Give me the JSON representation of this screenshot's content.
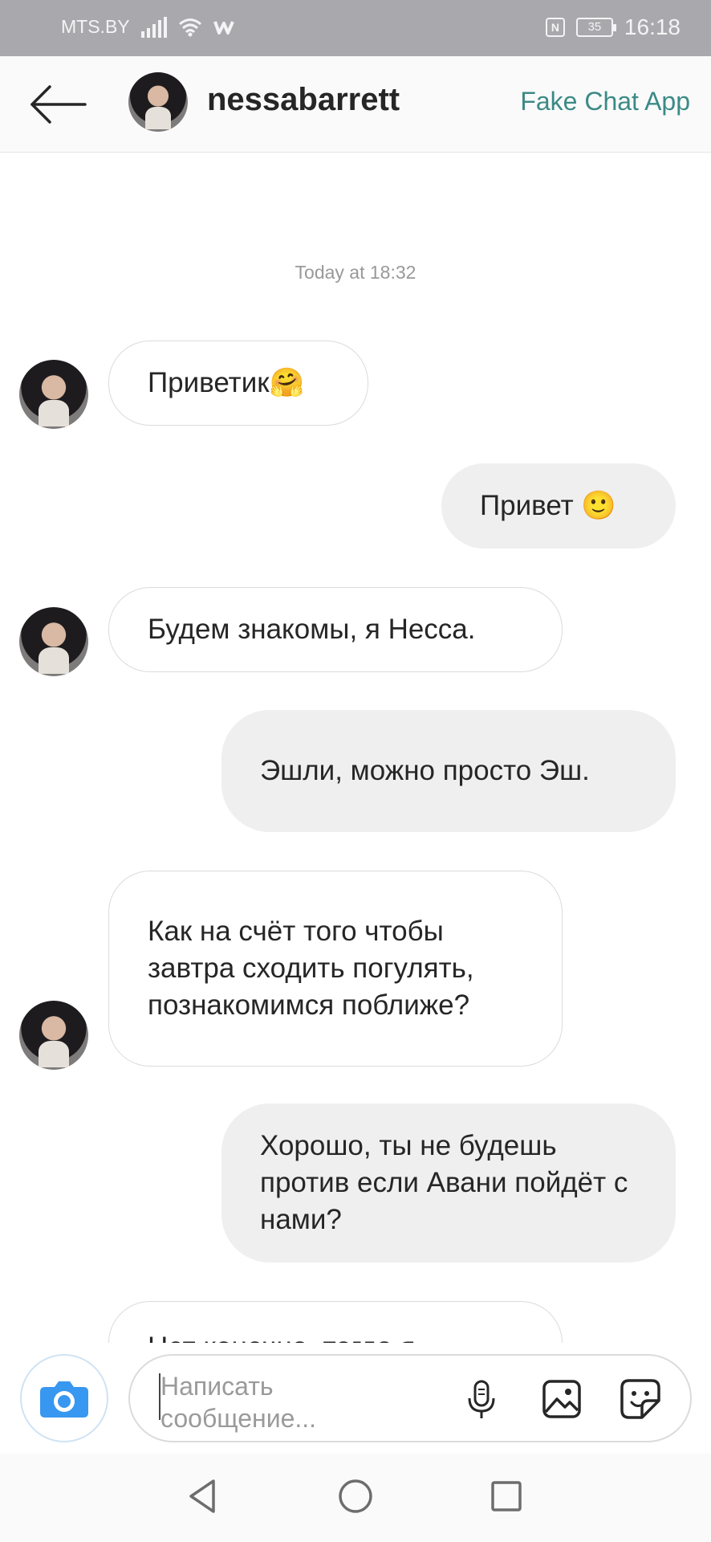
{
  "status_bar": {
    "carrier": "MTS.BY",
    "battery": "35",
    "time": "16:18"
  },
  "header": {
    "username": "nessabarrett",
    "app_label": "Fake Chat App"
  },
  "chat": {
    "timestamp": "Today at 18:32",
    "messages": [
      {
        "dir": "in",
        "text": "Приветик🤗"
      },
      {
        "dir": "out",
        "text": "Привет 🙂"
      },
      {
        "dir": "in",
        "text": "Будем знакомы, я Несса."
      },
      {
        "dir": "out",
        "text": "Эшли, можно просто Эш."
      },
      {
        "dir": "in",
        "text": "Как на счёт того чтобы завтра сходить погулять, познакомимся поближе?"
      },
      {
        "dir": "out",
        "text": "Хорошо, ты не будешь против если Авани пойдёт с нами?"
      },
      {
        "dir": "in",
        "text": "Нет конечно, тогда я"
      }
    ]
  },
  "composer": {
    "placeholder": "Написать сообщение..."
  },
  "colors": {
    "status_bar": "#a9a9ad",
    "link": "#3c8a86",
    "camera": "#3897f0",
    "incoming_border": "#dbdbdb",
    "outgoing_bg": "#efefef"
  },
  "icons": [
    "signal-icon",
    "wifi-icon",
    "nfc-icon",
    "battery-icon",
    "back-arrow-icon",
    "camera-icon",
    "microphone-icon",
    "gallery-icon",
    "sticker-icon",
    "nav-back-icon",
    "nav-home-icon",
    "nav-recents-icon"
  ]
}
